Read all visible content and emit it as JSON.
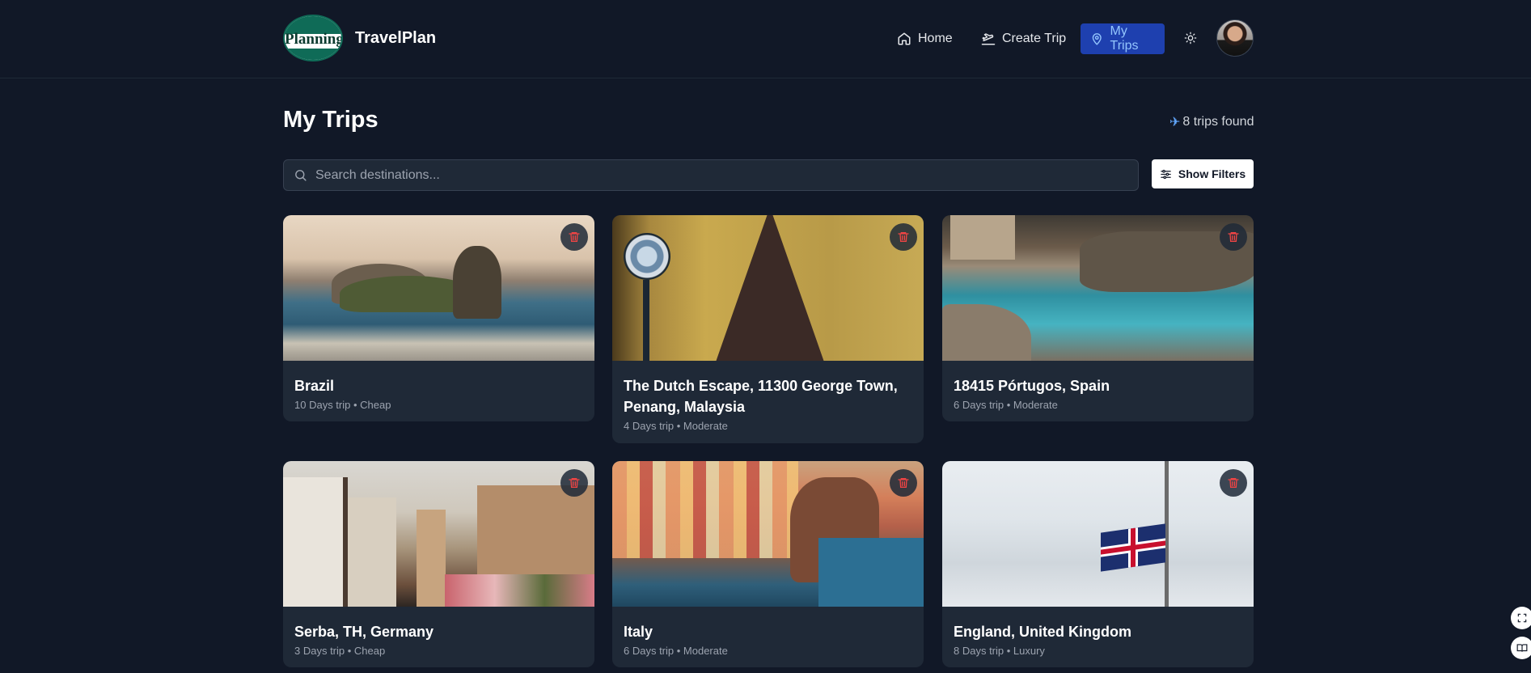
{
  "header": {
    "logo_text": "Planning",
    "brand": "TravelPlan",
    "nav": [
      {
        "label": "Home",
        "icon": "home-icon"
      },
      {
        "label": "Create Trip",
        "icon": "plane-departure-icon"
      },
      {
        "label": "My Trips",
        "icon": "map-pin-icon",
        "active": true
      }
    ],
    "theme_icon": "sun-icon"
  },
  "page": {
    "title": "My Trips",
    "trip_count": "8 trips found"
  },
  "search": {
    "placeholder": "Search destinations...",
    "value": ""
  },
  "filters": {
    "label": "Show Filters"
  },
  "trips": [
    {
      "name": "Brazil",
      "meta": "10 Days trip • Cheap"
    },
    {
      "name": "The Dutch Escape, 11300 George Town, Penang, Malaysia",
      "meta": "4 Days trip • Moderate"
    },
    {
      "name": "18415 Pórtugos, Spain",
      "meta": "6 Days trip • Moderate"
    },
    {
      "name": "Serba, TH, Germany",
      "meta": "3 Days trip • Cheap"
    },
    {
      "name": "Italy",
      "meta": "6 Days trip • Moderate"
    },
    {
      "name": "England, United Kingdom",
      "meta": "8 Days trip • Luxury"
    }
  ],
  "colors": {
    "background": "#111827",
    "card": "#1f2937",
    "active_nav": "#1e40af",
    "delete_icon": "#ef4444"
  }
}
